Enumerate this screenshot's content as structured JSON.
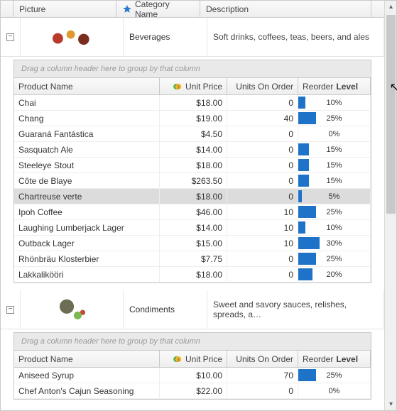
{
  "master_columns": {
    "picture": "Picture",
    "category": "Category Name",
    "description": "Description"
  },
  "detail_columns": {
    "product": "Product Name",
    "price": "Unit Price",
    "units": "Units On Order",
    "reorder_label_a": "Reorder ",
    "reorder_label_b": "Level"
  },
  "group_panel_text": "Drag a column header here to group by that column",
  "categories": [
    {
      "name": "Beverages",
      "description": "Soft drinks, coffees, teas, beers, and ales",
      "products": [
        {
          "name": "Chai",
          "price": "$18.00",
          "units": "0",
          "reorder": 10,
          "hl": false
        },
        {
          "name": "Chang",
          "price": "$19.00",
          "units": "40",
          "reorder": 25,
          "hl": false
        },
        {
          "name": "Guaraná Fantástica",
          "price": "$4.50",
          "units": "0",
          "reorder": 0,
          "hl": false
        },
        {
          "name": "Sasquatch Ale",
          "price": "$14.00",
          "units": "0",
          "reorder": 15,
          "hl": false
        },
        {
          "name": "Steeleye Stout",
          "price": "$18.00",
          "units": "0",
          "reorder": 15,
          "hl": false
        },
        {
          "name": "Côte de Blaye",
          "price": "$263.50",
          "units": "0",
          "reorder": 15,
          "hl": false
        },
        {
          "name": "Chartreuse verte",
          "price": "$18.00",
          "units": "0",
          "reorder": 5,
          "hl": true
        },
        {
          "name": "Ipoh Coffee",
          "price": "$46.00",
          "units": "10",
          "reorder": 25,
          "hl": false
        },
        {
          "name": "Laughing Lumberjack Lager",
          "price": "$14.00",
          "units": "10",
          "reorder": 10,
          "hl": false
        },
        {
          "name": "Outback Lager",
          "price": "$15.00",
          "units": "10",
          "reorder": 30,
          "hl": false
        },
        {
          "name": "Rhönbräu Klosterbier",
          "price": "$7.75",
          "units": "0",
          "reorder": 25,
          "hl": false
        },
        {
          "name": "Lakkalikööri",
          "price": "$18.00",
          "units": "0",
          "reorder": 20,
          "hl": false
        }
      ]
    },
    {
      "name": "Condiments",
      "description": "Sweet and savory sauces, relishes, spreads, a…",
      "products": [
        {
          "name": "Aniseed Syrup",
          "price": "$10.00",
          "units": "70",
          "reorder": 25,
          "hl": false
        },
        {
          "name": "Chef Anton's Cajun Seasoning",
          "price": "$22.00",
          "units": "0",
          "reorder": 0,
          "hl": false
        }
      ]
    }
  ]
}
